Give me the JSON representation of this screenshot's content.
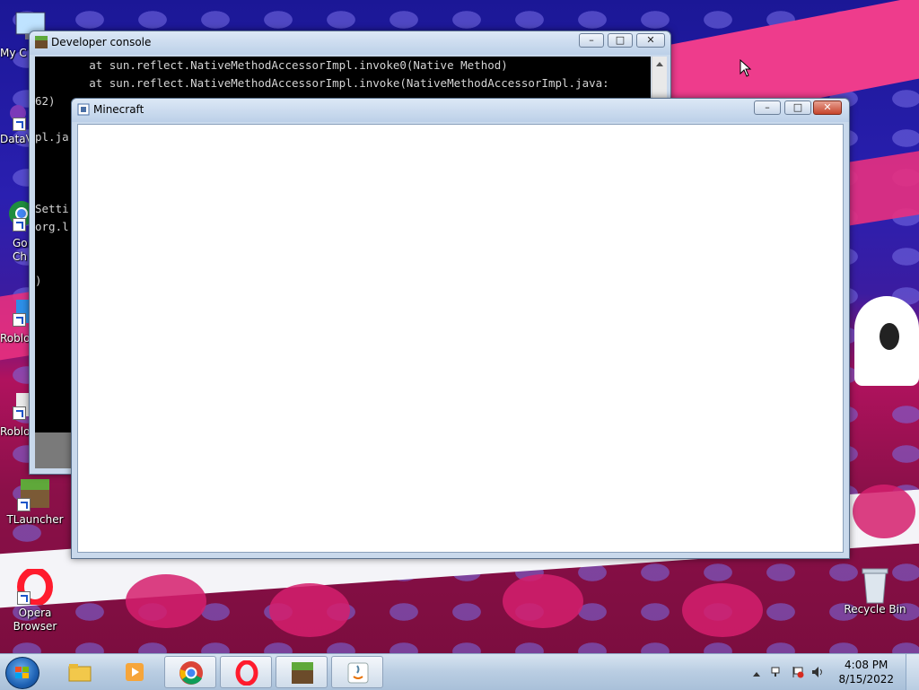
{
  "desktop": {
    "icons": [
      {
        "label": "My C"
      },
      {
        "label": "DataV"
      },
      {
        "label": "Go\nCh"
      },
      {
        "label": "Roblo"
      },
      {
        "label": "Roblo"
      },
      {
        "label": "TLauncher"
      },
      {
        "label": "Opera\nBrowser"
      },
      {
        "label": "Recycle Bin"
      }
    ]
  },
  "console_window": {
    "title": "Developer console",
    "lines": [
      "        at sun.reflect.NativeMethodAccessorImpl.invoke0(Native Method)",
      "        at sun.reflect.NativeMethodAccessorImpl.invoke(NativeMethodAccessorImpl.java:",
      "62)",
      "",
      "pl.ja",
      "",
      "",
      "",
      "Setti",
      "org.l",
      "",
      "",
      ")"
    ],
    "minimize": "–",
    "maximize": "□",
    "close": "✕"
  },
  "minecraft_window": {
    "title": "Minecraft",
    "minimize": "–",
    "maximize": "□",
    "close": "✕"
  },
  "taskbar": {
    "pinned": [
      {
        "icon": "explorer-icon"
      },
      {
        "icon": "media-player-icon"
      },
      {
        "icon": "chrome-icon"
      },
      {
        "icon": "opera-icon"
      },
      {
        "icon": "minecraft-icon"
      },
      {
        "icon": "java-icon"
      }
    ],
    "clock": {
      "time": "4:08 PM",
      "date": "8/15/2022"
    },
    "colors": {
      "accent": "#1f62b4"
    }
  }
}
